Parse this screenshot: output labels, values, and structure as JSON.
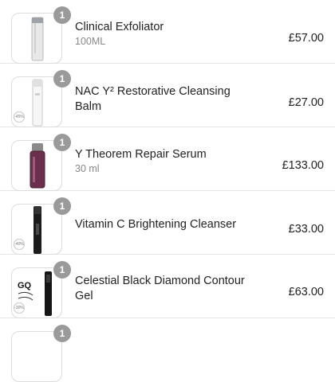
{
  "items": [
    {
      "qty": "1",
      "name": "Clinical Exfoliator",
      "subtitle": "100ML",
      "price": "£57.00",
      "badge": "",
      "image_icon": "tall-bottle-icon"
    },
    {
      "qty": "1",
      "name": "NAC Y² Restorative Cleansing Balm",
      "subtitle": "",
      "price": "£27.00",
      "badge": "-45%",
      "image_icon": "white-bottle-icon"
    },
    {
      "qty": "1",
      "name": "Y Theorem Repair Serum",
      "subtitle": "30 ml",
      "price": "£133.00",
      "badge": "",
      "image_icon": "serum-bottle-icon"
    },
    {
      "qty": "1",
      "name": "Vitamin C Brightening Cleanser",
      "subtitle": "",
      "price": "£33.00",
      "badge": "-40%",
      "image_icon": "black-bottle-icon"
    },
    {
      "qty": "1",
      "name": "Celestial Black Diamond Contour Gel",
      "subtitle": "",
      "price": "£63.00",
      "badge": "-30%",
      "image_icon": "gq-award-tube-icon"
    },
    {
      "qty": "1",
      "name": "",
      "subtitle": "",
      "price": "",
      "badge": "",
      "image_icon": "product-thumbnail-icon"
    }
  ],
  "colors": {
    "qty_badge": "#9a9a9a",
    "text": "#222222",
    "subtext": "#888888",
    "border": "#dcdcdc"
  }
}
